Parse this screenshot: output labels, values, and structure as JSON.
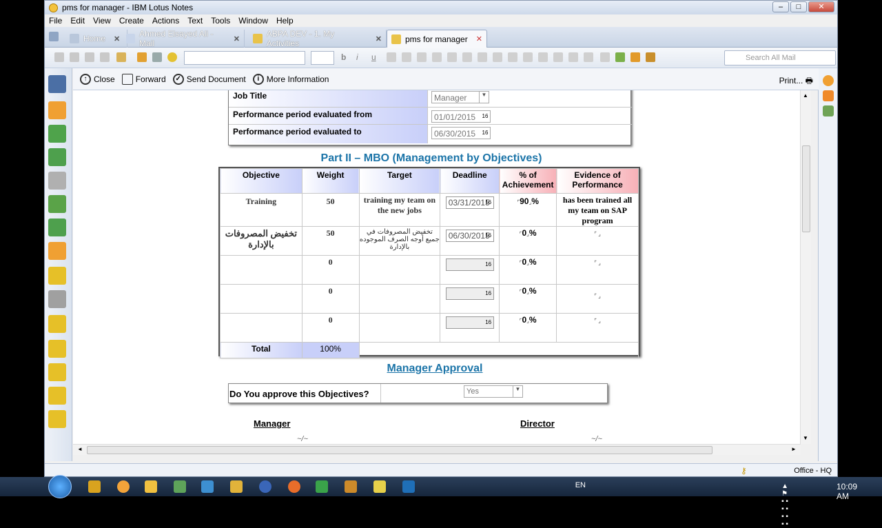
{
  "window": {
    "title": "pms for manager - IBM Lotus Notes"
  },
  "menu": [
    "File",
    "Edit",
    "View",
    "Create",
    "Actions",
    "Text",
    "Tools",
    "Window",
    "Help"
  ],
  "tabs": [
    {
      "label": "Home"
    },
    {
      "label": "Ahmed Elsayed Ali - Mail"
    },
    {
      "label": "ABPA DEV - 1. My Activities"
    },
    {
      "label": "pms for manager"
    }
  ],
  "toolbar": {
    "search_placeholder": "Search All Mail"
  },
  "actions": {
    "close": "Close",
    "forward": "Forward",
    "send": "Send Document",
    "more": "More Information",
    "print": "Print..."
  },
  "form": {
    "job_title_label": "Job Title",
    "job_title_value": "Manager",
    "period_from_label": "Performance period evaluated from",
    "period_from_value": "01/01/2015",
    "period_to_label": "Performance period  evaluated to",
    "period_to_value": "06/30/2015",
    "cal_icon": "16"
  },
  "mbo": {
    "title": "Part II – MBO (Management by Objectives)",
    "headers": {
      "objective": "Objective",
      "weight": "Weight",
      "target": "Target",
      "deadline": "Deadline",
      "achievement": "% of Achievement",
      "evidence": "Evidence of Performance"
    },
    "rows": [
      {
        "objective": "Training",
        "weight": "50",
        "target": "training my team on the new jobs",
        "deadline": "03/31/2015",
        "achievement": "90",
        "evidence": "has been trained all my team on SAP program"
      },
      {
        "objective": "تخفيض المصروفات بالإدارة",
        "weight": "50",
        "target": "تخفيض المصروفات في جميع أوجه الصرف الموجوده بالإدارة",
        "deadline": "06/30/2015",
        "achievement": "0",
        "evidence": ""
      },
      {
        "objective": "",
        "weight": "0",
        "target": "",
        "deadline": "",
        "achievement": "0",
        "evidence": ""
      },
      {
        "objective": "",
        "weight": "0",
        "target": "",
        "deadline": "",
        "achievement": "0",
        "evidence": ""
      },
      {
        "objective": "",
        "weight": "0",
        "target": "",
        "deadline": "",
        "achievement": "0",
        "evidence": ""
      }
    ],
    "total_label": "Total",
    "total_value": "100%",
    "pct_sign": "%"
  },
  "approval": {
    "title": "Manager  Approval",
    "question": "Do You approve this Objectives?",
    "answer": "Yes",
    "manager_label": "Manager",
    "director_label": "Director"
  },
  "status": {
    "location": "Office - HQ"
  },
  "tray": {
    "lang": "EN",
    "time": "10:09 AM"
  }
}
